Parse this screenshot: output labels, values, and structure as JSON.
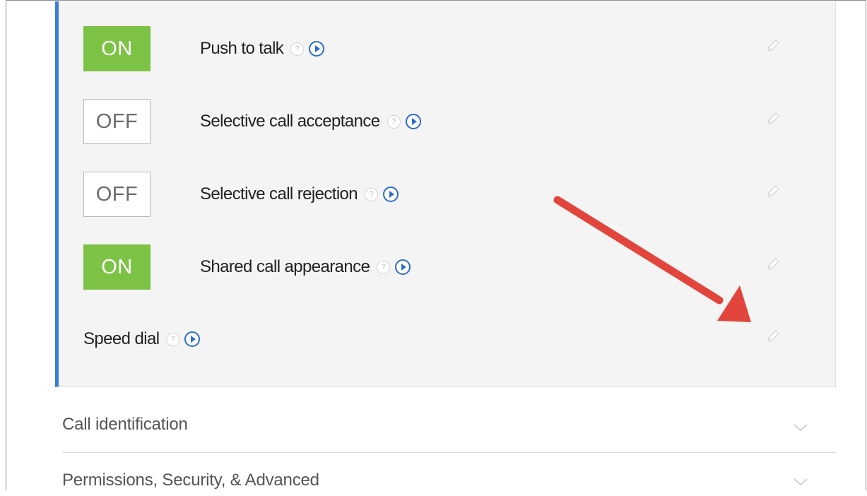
{
  "features": [
    {
      "toggle": "ON",
      "label": "Push to talk",
      "state": "on",
      "help_icon": "?"
    },
    {
      "toggle": "OFF",
      "label": "Selective call acceptance",
      "state": "off",
      "help_icon": "?"
    },
    {
      "toggle": "OFF",
      "label": "Selective call rejection",
      "state": "off",
      "help_icon": "?"
    },
    {
      "toggle": "ON",
      "label": "Shared call appearance",
      "state": "on",
      "help_icon": "?"
    }
  ],
  "speed_dial": {
    "label": "Speed dial",
    "help_icon": "?"
  },
  "sections": [
    {
      "title": "Call identification"
    },
    {
      "title": "Permissions, Security, & Advanced"
    }
  ],
  "colors": {
    "on_toggle": "#7cc245",
    "accent_bar": "#3b7dd8",
    "play_icon": "#2b6cd0",
    "annotation_arrow": "#e2453b"
  },
  "icons": {
    "help": "question-circle-icon",
    "play": "play-circle-icon",
    "edit": "pencil-icon",
    "expand": "chevron-down-icon"
  }
}
